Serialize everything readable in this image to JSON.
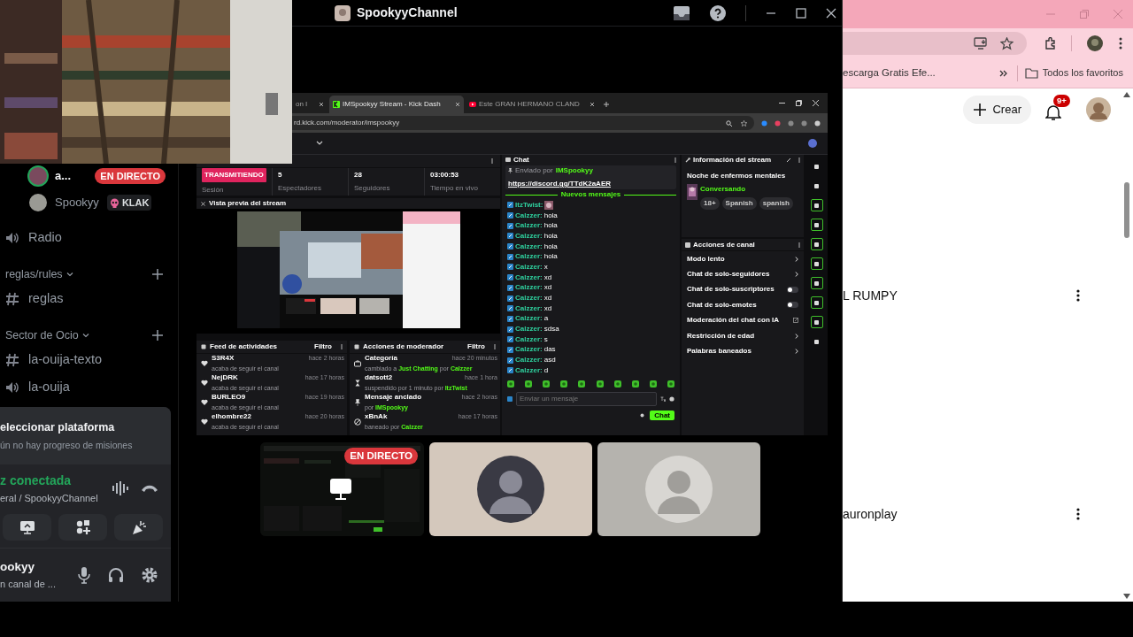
{
  "discord": {
    "title": "SpookyyChannel",
    "voice_users": [
      {
        "name": "a...",
        "speaking": true,
        "badge": {
          "kind": "live",
          "label": "EN DIRECTO"
        }
      },
      {
        "name": "Spookyy",
        "speaking": false,
        "badge": {
          "kind": "tag",
          "label": "KLAK"
        }
      }
    ],
    "channels": [
      {
        "kind": "voice",
        "name": "Radio"
      },
      {
        "kind": "category",
        "name": "reglas/rules"
      },
      {
        "kind": "text",
        "name": "reglas"
      },
      {
        "kind": "category",
        "name": "Sector de Ocio"
      },
      {
        "kind": "text",
        "name": "la-ouija-texto"
      },
      {
        "kind": "voice",
        "name": "la-ouija"
      }
    ],
    "quest": {
      "title": "eleccionar plataforma",
      "subtitle": "ún no hay progreso de misiones"
    },
    "voice": {
      "status": "z conectada",
      "channel": "eral / SpookyyChannel"
    },
    "user": {
      "name": "ookyy",
      "status": "n canal de ..."
    },
    "tiles": [
      {
        "kind": "stream",
        "badge": "EN DIRECTO"
      },
      {
        "kind": "avatar"
      },
      {
        "kind": "avatar"
      }
    ]
  },
  "stream_view": {
    "tabs": [
      {
        "label": "on I",
        "selected": false
      },
      {
        "label": "IMSpookyy Stream - Kick Dash",
        "selected": true
      },
      {
        "label": "Este GRAN HERMANO CLAND",
        "selected": false
      }
    ],
    "url": "rd.kick.com/moderator/imspookyy",
    "stats": [
      {
        "kind": "badge",
        "value": "TRANSMITIENDO",
        "label": "Sesión"
      },
      {
        "kind": "text",
        "value": "5",
        "label": "Espectadores"
      },
      {
        "kind": "text",
        "value": "28",
        "label": "Seguidores"
      },
      {
        "kind": "text",
        "value": "03:00:53",
        "label": "Tiempo en vivo"
      }
    ],
    "preview_title": "Vista previa del stream",
    "activity": {
      "title": "Feed de actividades",
      "filter": "Filtro",
      "items": [
        {
          "kind": "follow",
          "name": "S3R4X",
          "detail": "acaba de seguir el canal",
          "time": "hace 2 horas"
        },
        {
          "kind": "follow",
          "name": "NejDRK",
          "detail": "acaba de seguir el canal",
          "time": "hace 17 horas"
        },
        {
          "kind": "follow",
          "name": "BURLEO9",
          "detail": "acaba de seguir el canal",
          "time": "hace 19 horas"
        },
        {
          "kind": "follow",
          "name": "elhombre22",
          "detail": "acaba de seguir el canal",
          "time": "hace 20 horas"
        }
      ]
    },
    "mod_actions": {
      "title": "Acciones de moderador",
      "filter": "Filtro",
      "items": [
        {
          "kind": "category",
          "name": "Categoría",
          "detail": "cambiado a **Just Chatting** por **Calzzer**",
          "time": "hace 20 minutos"
        },
        {
          "kind": "timeout",
          "name": "datsott2",
          "detail": "suspendido por 1 minuto por **ItzTwist**",
          "time": "hace 1 hora"
        },
        {
          "kind": "pin",
          "name": "Mensaje anclado",
          "detail": "por **IMSpookyy**",
          "time": "hace 2 horas"
        },
        {
          "kind": "ban",
          "name": "xBnAk",
          "detail": "baneado por **Calzzer**",
          "time": "hace 17 horas"
        }
      ]
    },
    "chat": {
      "title": "Chat",
      "pinned_by": "Enviado por",
      "pinned_user": "IMSpookyy",
      "pinned_link": "https://discord.gg/TTdK2aAER",
      "divider": "Nuevos mensajes",
      "messages": [
        {
          "kind": "emote",
          "user": "ItzTwist:"
        },
        {
          "kind": "text",
          "user": "Calzzer:",
          "text": "hola"
        },
        {
          "kind": "text",
          "user": "Calzzer:",
          "text": "hola"
        },
        {
          "kind": "text",
          "user": "Calzzer:",
          "text": "hola"
        },
        {
          "kind": "text",
          "user": "Calzzer:",
          "text": "hola"
        },
        {
          "kind": "text",
          "user": "Calzzer:",
          "text": "hola"
        },
        {
          "kind": "text",
          "user": "Calzzer:",
          "text": "x"
        },
        {
          "kind": "text",
          "user": "Calzzer:",
          "text": "xd"
        },
        {
          "kind": "text",
          "user": "Calzzer:",
          "text": "xd"
        },
        {
          "kind": "text",
          "user": "Calzzer:",
          "text": "xd"
        },
        {
          "kind": "text",
          "user": "Calzzer:",
          "text": "xd"
        },
        {
          "kind": "text",
          "user": "Calzzer:",
          "text": "a"
        },
        {
          "kind": "text",
          "user": "Calzzer:",
          "text": "sdsa"
        },
        {
          "kind": "text",
          "user": "Calzzer:",
          "text": "s"
        },
        {
          "kind": "text",
          "user": "Calzzer:",
          "text": "das"
        },
        {
          "kind": "text",
          "user": "Calzzer:",
          "text": "asd"
        },
        {
          "kind": "text",
          "user": "Calzzer:",
          "text": "d"
        }
      ],
      "placeholder": "Enviar un mensaje",
      "send": "Chat"
    },
    "info": {
      "title": "Información del stream",
      "stream_title": "Noche de enfermos mentales",
      "category": "Conversando",
      "tags": [
        "18+",
        "Spanish",
        "spanish"
      ]
    },
    "channel_actions": {
      "title": "Acciones de canal",
      "items": [
        {
          "kind": "link",
          "label": "Modo lento"
        },
        {
          "kind": "link",
          "label": "Chat de solo-seguidores"
        },
        {
          "kind": "toggle",
          "label": "Chat de solo-suscriptores",
          "on": false
        },
        {
          "kind": "toggle",
          "label": "Chat de solo-emotes",
          "on": false
        },
        {
          "kind": "external",
          "label": "Moderación del chat con IA"
        },
        {
          "kind": "link",
          "label": "Restricción de edad"
        },
        {
          "kind": "link",
          "label": "Palabras baneados"
        }
      ]
    }
  },
  "browser": {
    "bookmark": "escarga Gratis Efe...",
    "all_bookmarks": "Todos los favoritos",
    "create": "Crear",
    "notifications": "9+",
    "items": [
      {
        "title": "L RUMPY"
      },
      {
        "title": "auronplay"
      }
    ]
  }
}
